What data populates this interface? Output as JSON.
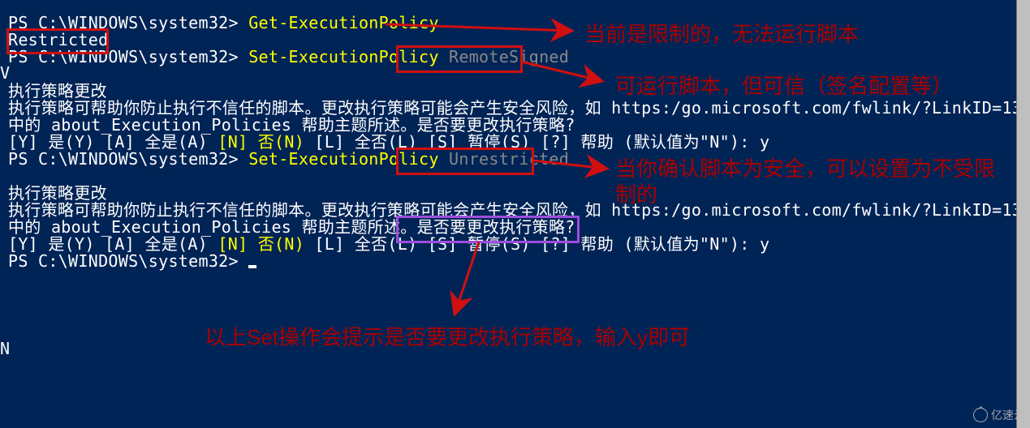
{
  "prompt": "PS C:\\WINDOWS\\system32> ",
  "cmds": {
    "get": "Get-ExecutionPolicy",
    "set": "Set-ExecutionPolicy",
    "arg_remote": " RemoteSigned",
    "arg_unrestricted": " Unrestricted"
  },
  "output": {
    "restricted": "Restricted",
    "title": "执行策略更改",
    "warn1": "执行策略可帮助你防止执行不信任的脚本。更改执行策略可能会产生安全风险，如 https:/go.microsoft.com/fwlink/?LinkID=13",
    "warn2_pre": "中的 about_Execution_Policies 帮助主题所述。",
    "warn2_q": "是否要更改执行策略?",
    "options_pre": "[Y] 是(Y)  [A] 全是(A)  ",
    "options_no": "[N] 否(N)",
    "options_post": "  [L] 全否(L)  [S] 暂停(S)  [?] 帮助 (默认值为\"N\"): ",
    "answer": "y"
  },
  "stray": {
    "v": "V",
    "n": "N"
  },
  "annotations": {
    "a1": "当前是限制的，无法运行脚本",
    "a2": "可运行脚本，但可信（签名配置等）",
    "a3_l1": "当你确认脚本为安全，可以设置为不受限",
    "a3_l2": "制的",
    "a4": "以上Set操作会提示是否要更改执行策略，输入y即可"
  },
  "watermark": "亿速云"
}
